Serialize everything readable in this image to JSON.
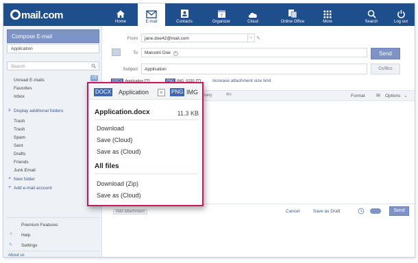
{
  "header": {
    "logo": "mail.com",
    "nav": [
      {
        "label": "Home",
        "icon": "home-icon"
      },
      {
        "label": "E-mail",
        "icon": "envelope-icon"
      },
      {
        "label": "Contacts",
        "icon": "contacts-icon"
      },
      {
        "label": "Organizer",
        "icon": "calendar-icon"
      },
      {
        "label": "Cloud",
        "icon": "cloud-icon"
      },
      {
        "label": "Online Office",
        "icon": "office-icon"
      },
      {
        "label": "More",
        "icon": "grid-icon"
      },
      {
        "label": "Search",
        "icon": "search-icon"
      },
      {
        "label": "Log out",
        "icon": "power-icon"
      }
    ],
    "calendar_day": "7",
    "active_tab": "E-mail"
  },
  "sidebar": {
    "compose_label": "Compose E-mail",
    "draft_item": "Application",
    "search_placeholder": "Search",
    "folders": [
      "Unread E-mails",
      "Favorites",
      "Inbox"
    ],
    "unread_count": "19",
    "display_additional": "Display additional folders",
    "more_folders": [
      "Trash",
      "Trash",
      "Spam",
      "Sent",
      "Drafts",
      "Friends",
      "Junk Email"
    ],
    "new_folder": "New folder",
    "add_account": "Add e-mail account",
    "premium": "Premium Features",
    "help": "Help",
    "settings": "Settings",
    "about": "About us"
  },
  "compose": {
    "from_label": "From",
    "from_value": "jane.doe42@mail.com",
    "to_label": "To",
    "to_value": "Malcolm Doe",
    "subject_label": "Subject",
    "subject_value": "Application",
    "send_label": "Send",
    "cc_bcc_label": "Cc/Bcc",
    "attachments": [
      {
        "type": "DOCX",
        "name": "Application"
      },
      {
        "type": "PNG",
        "name": "IMG_0230"
      }
    ],
    "increase_limit": "Increase attachment size limit",
    "toolbar_fragment": "nery",
    "format_label": "Format",
    "options_label": "Options"
  },
  "bottom": {
    "add_attachment": "Add attachment",
    "cancel": "Cancel",
    "save_draft": "Save as Draft",
    "send": "Send"
  },
  "popover": {
    "tab_type": "DOCX",
    "tab_name": "Application",
    "next_type": "PNG",
    "next_name": "IMG",
    "file_name": "Application.docx",
    "file_size": "11.3 KB",
    "file_actions": [
      "Download",
      "Save (Cloud)",
      "Save as (Cloud)"
    ],
    "all_files_title": "All files",
    "all_actions": [
      "Download (Zip)",
      "Save as (Cloud)"
    ]
  },
  "colors": {
    "header_bg": "#1f4e8c",
    "accent": "#7e94c6",
    "popover_border": "#c8175a",
    "tag_blue": "#3d68b1"
  }
}
